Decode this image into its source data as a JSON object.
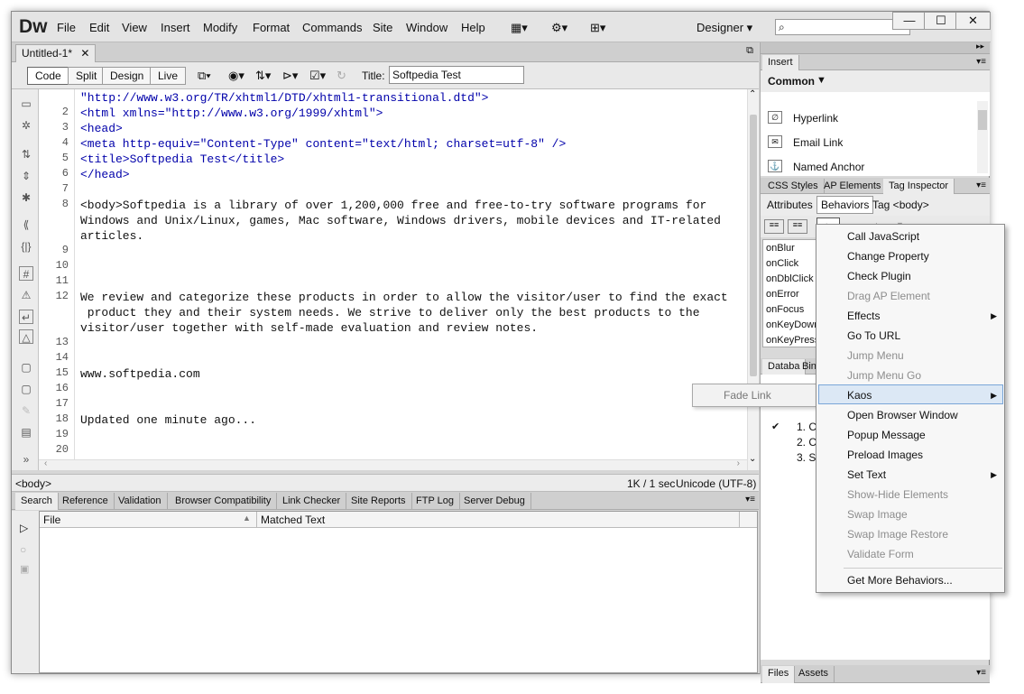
{
  "app": {
    "logo": "Dw",
    "workspace": "Designer"
  },
  "menu": [
    "File",
    "Edit",
    "View",
    "Insert",
    "Modify",
    "Format",
    "Commands",
    "Site",
    "Window",
    "Help"
  ],
  "document": {
    "tab_label": "Untitled-1*",
    "close_glyph": "✕"
  },
  "view_buttons": [
    "Code",
    "Split",
    "Design",
    "Live"
  ],
  "title_field": {
    "label": "Title:",
    "value": "Softpedia Test"
  },
  "line_numbers": [
    "2",
    "3",
    "4",
    "5",
    "6",
    "7",
    "8",
    "9",
    "10",
    "11",
    "12",
    "13",
    "14",
    "15",
    "16",
    "17",
    "18",
    "19",
    "20"
  ],
  "code_lines": [
    "\"http://www.w3.org/TR/xhtml1/DTD/xhtml1-transitional.dtd\">",
    "<html xmlns=\"http://www.w3.org/1999/xhtml\">",
    "<head>",
    "<meta http-equiv=\"Content-Type\" content=\"text/html; charset=utf-8\" />",
    "<title>Softpedia Test</title>",
    "</head>",
    "<body>Softpedia is a library of over 1,200,000 free and free-to-try software programs for",
    "Windows and Unix/Linux, games, Mac software, Windows drivers, mobile devices and IT-related",
    "articles.",
    "We review and categorize these products in order to allow the visitor/user to find the exact",
    " product they and their system needs. We strive to deliver only the best products to the",
    "visitor/user together with self-made evaluation and review notes.",
    "www.softpedia.com",
    "Updated one minute ago..."
  ],
  "status": {
    "tag": "<body>",
    "size": "1K / 1 sec",
    "encoding": "Unicode (UTF-8)"
  },
  "bottom_tabs": [
    "Search",
    "Reference",
    "Validation",
    "Browser Compatibility",
    "Link Checker",
    "Site Reports",
    "FTP Log",
    "Server Debug"
  ],
  "results_columns": [
    "File",
    "Matched Text"
  ],
  "insert_panel": {
    "title": "Insert",
    "category": "Common",
    "items": [
      "Hyperlink",
      "Email Link",
      "Named Anchor"
    ]
  },
  "tag_panel_tabs": [
    "CSS Styles",
    "AP Elements",
    "Tag Inspector"
  ],
  "tag_inspector": {
    "attributes": "Attributes",
    "behaviors": "Behaviors",
    "tag": "Tag <body>",
    "add": "+."
  },
  "events": [
    "onBlur",
    "onClick",
    "onDblClick",
    "onError",
    "onFocus",
    "onKeyDown",
    "onKeyPress"
  ],
  "db_tabs": [
    "Databa",
    "Bin"
  ],
  "binding_list": [
    "1. C",
    "2. C",
    "3. S"
  ],
  "files_tabs": [
    "Files",
    "Assets"
  ],
  "behaviors_menu": [
    {
      "label": "Call JavaScript",
      "disabled": false,
      "sub": false
    },
    {
      "label": "Change Property",
      "disabled": false,
      "sub": false
    },
    {
      "label": "Check Plugin",
      "disabled": false,
      "sub": false
    },
    {
      "label": "Drag AP Element",
      "disabled": true,
      "sub": false
    },
    {
      "label": "Effects",
      "disabled": false,
      "sub": true
    },
    {
      "label": "Go To URL",
      "disabled": false,
      "sub": false
    },
    {
      "label": "Jump Menu",
      "disabled": true,
      "sub": false
    },
    {
      "label": "Jump Menu Go",
      "disabled": true,
      "sub": false
    },
    {
      "label": "Kaos",
      "disabled": false,
      "sub": true
    },
    {
      "label": "Open Browser Window",
      "disabled": false,
      "sub": false
    },
    {
      "label": "Popup Message",
      "disabled": false,
      "sub": false
    },
    {
      "label": "Preload Images",
      "disabled": false,
      "sub": false
    },
    {
      "label": "Set Text",
      "disabled": false,
      "sub": true
    },
    {
      "label": "Show-Hide Elements",
      "disabled": true,
      "sub": false
    },
    {
      "label": "Swap Image",
      "disabled": true,
      "sub": false
    },
    {
      "label": "Swap Image Restore",
      "disabled": true,
      "sub": false
    },
    {
      "label": "Validate Form",
      "disabled": true,
      "sub": false
    },
    {
      "label": "Get More Behaviors...",
      "disabled": false,
      "sub": false
    }
  ],
  "kaos_submenu": [
    "Fade Link"
  ]
}
